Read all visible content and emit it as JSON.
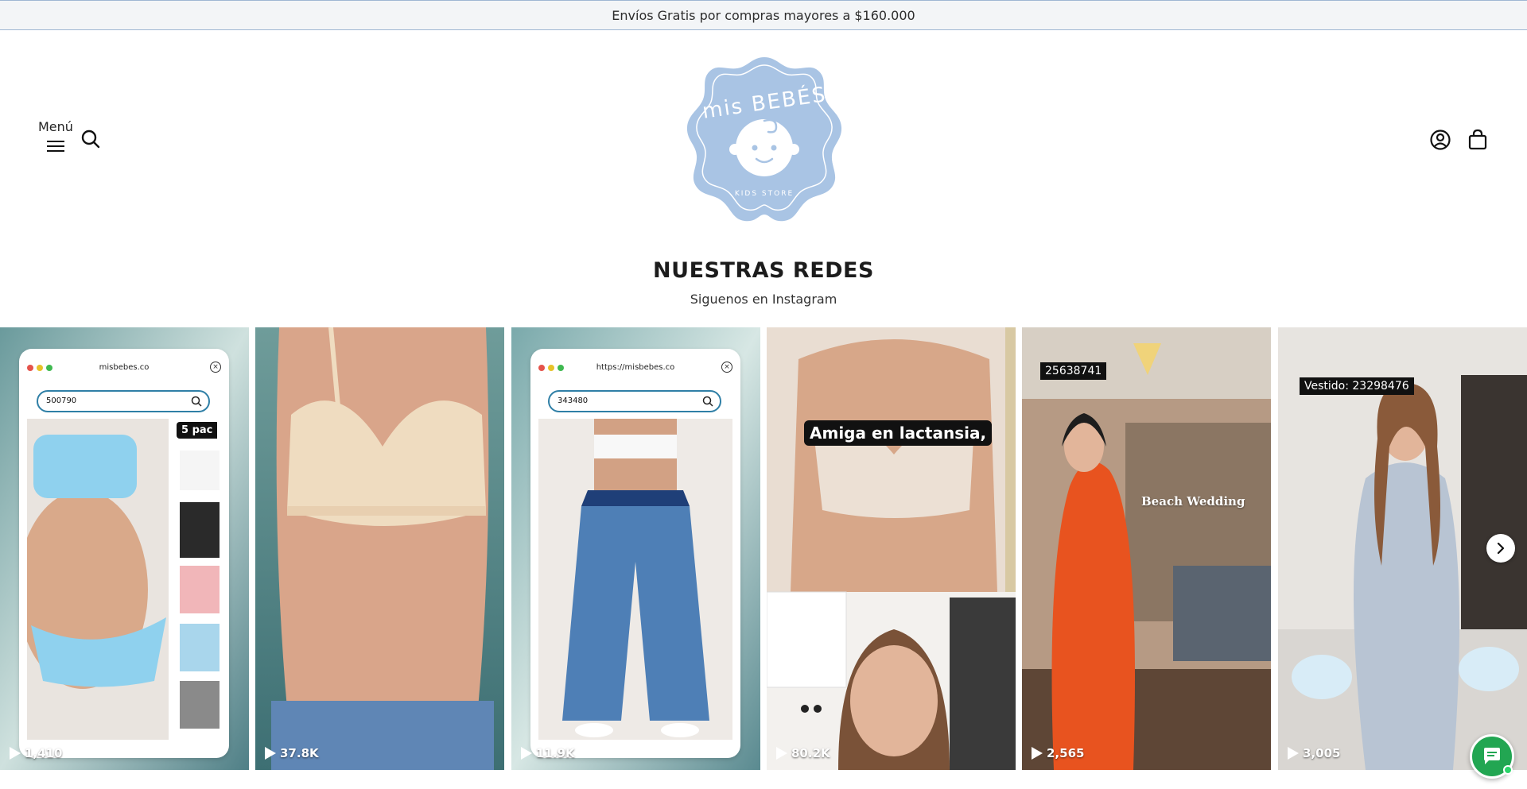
{
  "announcement": {
    "text": "Envíos Gratis por compras mayores a $160.000"
  },
  "header": {
    "menu_label": "Menú",
    "logo": {
      "brand": "MIS BEBÉS",
      "tagline": "KIDS STORE",
      "color": "#a9c4e4"
    },
    "icons": [
      "hamburger-icon",
      "search-icon",
      "account-icon",
      "cart-icon"
    ]
  },
  "section": {
    "title": "NUESTRAS REDES",
    "subtitle": "Siguenos en Instagram"
  },
  "posts": [
    {
      "views": "1,410",
      "browser_url": "misbebes.co",
      "search_value": "500790",
      "tag": "5 pac"
    },
    {
      "views": "37.8K"
    },
    {
      "views": "11.9K",
      "browser_url": "https://misbebes.co",
      "search_value": "343480"
    },
    {
      "views": "80.2K",
      "caption": "Amiga en lactansia,"
    },
    {
      "views": "2,565",
      "code": "25638741",
      "caption": "Beach Wedding"
    },
    {
      "views": "3,005",
      "code": "Vestido: 23298476"
    }
  ],
  "colors": {
    "accent": "#a9c4e4",
    "chat": "#22a652",
    "announce_bg": "#f3f5f7"
  }
}
